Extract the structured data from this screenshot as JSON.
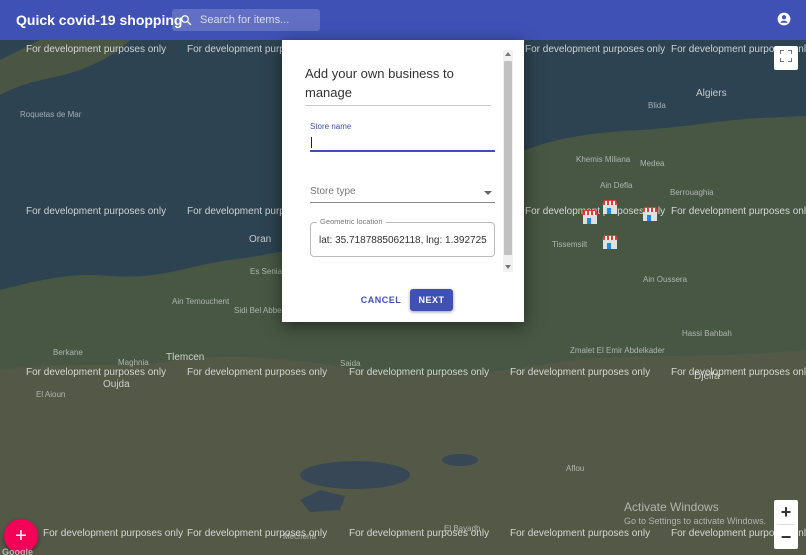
{
  "appbar": {
    "title": "Quick covid-19 shopping",
    "search_placeholder": "Search for items..."
  },
  "dialog": {
    "title": "Add your own business to manage",
    "store_name_label": "Store name",
    "store_name_value": "",
    "store_type_label": "Store type",
    "geo_label": "Geometric location",
    "geo_value": "lat: 35.7187885062118, lng: 1.392725",
    "cancel_label": "CANCEL",
    "next_label": "NEXT"
  },
  "map": {
    "watermark": "For development purposes only",
    "places": [
      "Oran",
      "Algiers",
      "Blida",
      "Medea",
      "Khemis Miliana",
      "Tissemsilt",
      "Sidi Bel Abbes",
      "Tlemcen",
      "Saida",
      "Ain Temouchent",
      "Maghnia",
      "Oujda",
      "Berkane",
      "El Aioun",
      "Ain Defla",
      "Berrouaghia",
      "Ain Oussera",
      "Hassi Bahbah",
      "Djelfa",
      "Mecheria",
      "El Bayadh",
      "Aflou",
      "Roquetas de Mar",
      "Es Senia",
      "Zmalet El Emir Abdelkader"
    ],
    "activate_line1": "Activate Windows",
    "activate_line2": "Go to Settings to activate Windows.",
    "zoom_in": "+",
    "zoom_out": "−",
    "fab_label": "+",
    "google_label": "Google"
  },
  "colors": {
    "primary": "#3f51b5",
    "accent": "#f50057"
  }
}
